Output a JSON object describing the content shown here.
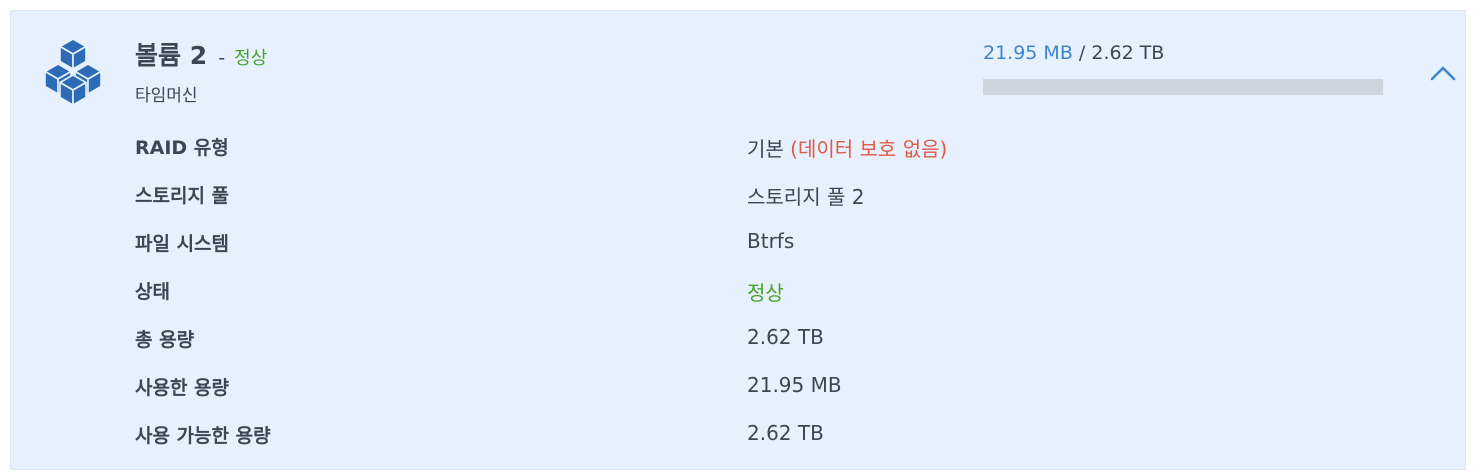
{
  "volume": {
    "name": "볼륨 2",
    "separator": "-",
    "status": "정상",
    "description": "타임머신",
    "icon": "cubes-icon"
  },
  "usage": {
    "used": "21.95 MB",
    "separator": " / ",
    "total": "2.62 TB",
    "fraction": 8.2e-06
  },
  "collapse_icon": "chevron-up-icon",
  "details": {
    "raid_type": {
      "label": "RAID 유형",
      "value": "기본",
      "note": "(데이터 보호 없음)"
    },
    "storage_pool": {
      "label": "스토리지 풀",
      "value": "스토리지 풀 2"
    },
    "file_system": {
      "label": "파일 시스템",
      "value": "Btrfs"
    },
    "status": {
      "label": "상태",
      "value": "정상"
    },
    "total_capacity": {
      "label": "총 용량",
      "value": "2.62 TB"
    },
    "used_capacity": {
      "label": "사용한 용량",
      "value": "21.95 MB"
    },
    "available_capacity": {
      "label": "사용 가능한 용량",
      "value": "2.62 TB"
    }
  },
  "colors": {
    "panel_bg": "#e7f1fd",
    "icon_blue": "#2d6bb7",
    "status_green": "#46a22a",
    "warning_red": "#df5a49",
    "link_blue": "#3d86cf",
    "bar_bg": "#cdd5de"
  }
}
